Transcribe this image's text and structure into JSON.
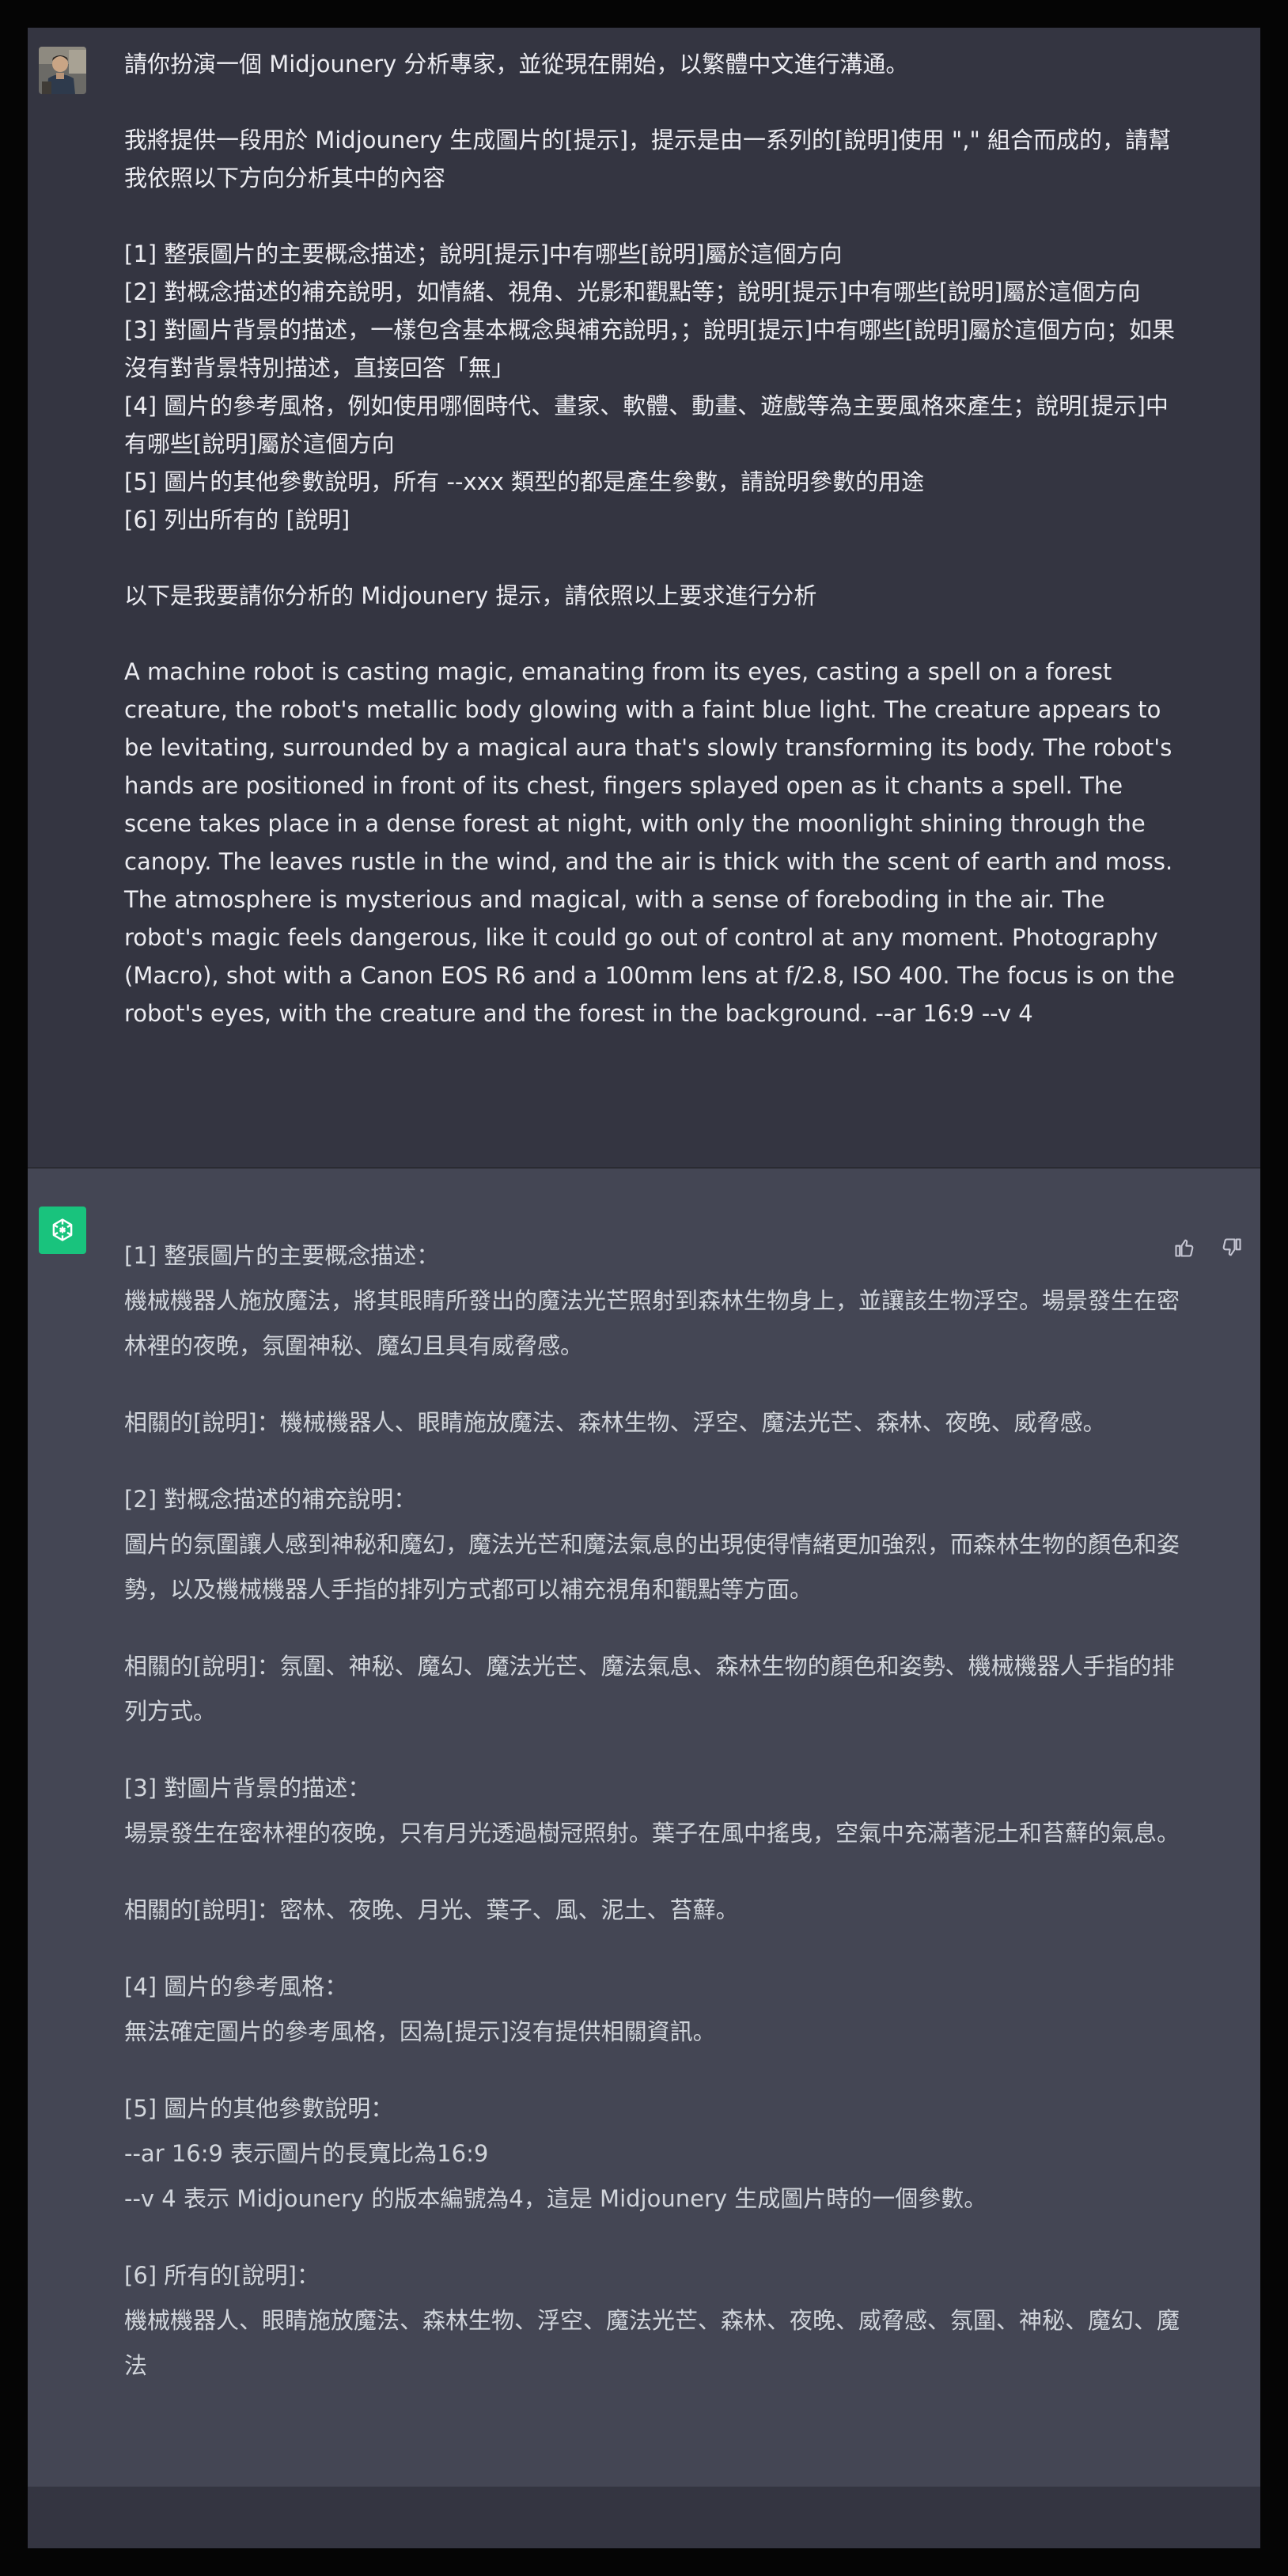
{
  "user": {
    "avatar_icon": "user-avatar-photo",
    "paragraphs": [
      "請你扮演一個 Midjounery 分析專家，並從現在開始，以繁體中文進行溝通。",
      "我將提供一段用於 Midjounery 生成圖片的[提示]，提示是由一系列的[說明]使用 \",\" 組合而成的，請幫我依照以下方向分析其中的內容",
      "[1] 整張圖片的主要概念描述；說明[提示]中有哪些[說明]屬於這個方向\n[2] 對概念描述的補充說明，如情緒、視角、光影和觀點等；說明[提示]中有哪些[說明]屬於這個方向\n[3] 對圖片背景的描述，一樣包含基本概念與補充說明，；說明[提示]中有哪些[說明]屬於這個方向；如果沒有對背景特別描述，直接回答「無」\n[4] 圖片的參考風格，例如使用哪個時代、畫家、軟體、動畫、遊戲等為主要風格來產生；說明[提示]中有哪些[說明]屬於這個方向\n[5] 圖片的其他參數說明，所有 --xxx 類型的都是產生參數，請說明參數的用途\n[6] 列出所有的 [說明]",
      "以下是我要請你分析的 Midjounery 提示，請依照以上要求進行分析",
      "A machine robot is casting magic, emanating from its eyes, casting a spell on a forest creature, the robot's metallic body glowing with a faint blue light. The creature appears to be levitating, surrounded by a magical aura that's slowly transforming its body. The robot's hands are positioned in front of its chest, fingers splayed open as it chants a spell. The scene takes place in a dense forest at night, with only the moonlight shining through the canopy. The leaves rustle in the wind, and the air is thick with the scent of earth and moss. The atmosphere is mysterious and magical, with a sense of foreboding in the air. The robot's magic feels dangerous, like it could go out of control at any moment. Photography (Macro), shot with a Canon EOS R6 and a 100mm lens at f/2.8, ISO 400. The focus is on the robot's eyes, with the creature and the forest in the background. --ar 16:9 --v 4"
    ]
  },
  "assistant": {
    "avatar_icon": "openai-logo-icon",
    "accent_color": "#19c37d",
    "actions": {
      "thumbs_up_icon": "thumbs-up-icon",
      "thumbs_down_icon": "thumbs-down-icon"
    },
    "paragraphs": [
      "[1] 整張圖片的主要概念描述：\n機械機器人施放魔法，將其眼睛所發出的魔法光芒照射到森林生物身上，並讓該生物浮空。場景發生在密林裡的夜晚，氛圍神秘、魔幻且具有威脅感。",
      "相關的[說明]：機械機器人、眼睛施放魔法、森林生物、浮空、魔法光芒、森林、夜晚、威脅感。",
      "[2] 對概念描述的補充說明：\n圖片的氛圍讓人感到神秘和魔幻，魔法光芒和魔法氣息的出現使得情緒更加強烈，而森林生物的顏色和姿勢，以及機械機器人手指的排列方式都可以補充視角和觀點等方面。",
      "相關的[說明]：氛圍、神秘、魔幻、魔法光芒、魔法氣息、森林生物的顏色和姿勢、機械機器人手指的排列方式。",
      "[3] 對圖片背景的描述：\n場景發生在密林裡的夜晚，只有月光透過樹冠照射。葉子在風中搖曳，空氣中充滿著泥土和苔蘚的氣息。",
      "相關的[說明]：密林、夜晚、月光、葉子、風、泥土、苔蘚。",
      "[4] 圖片的參考風格：\n無法確定圖片的參考風格，因為[提示]沒有提供相關資訊。",
      "[5] 圖片的其他參數說明：\n--ar 16:9 表示圖片的長寬比為16:9\n--v 4 表示 Midjounery 的版本編號為4，這是 Midjounery 生成圖片時的一個參數。",
      "[6] 所有的[說明]：\n機械機器人、眼睛施放魔法、森林生物、浮空、魔法光芒、森林、夜晚、威脅感、氛圍、神秘、魔幻、魔法"
    ]
  },
  "colors": {
    "user_bg": "#343541",
    "assistant_bg": "#444654",
    "outer_bg": "#050505",
    "text": "#ececf1"
  }
}
